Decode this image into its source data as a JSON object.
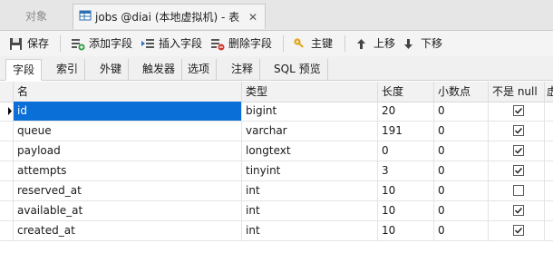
{
  "window_tabs": [
    {
      "label": "对象"
    },
    {
      "label": "jobs @diai (本地虚拟机) - 表",
      "close": "✕"
    }
  ],
  "toolbar": {
    "save": "保存",
    "add_field": "添加字段",
    "insert_field": "插入字段",
    "delete_field": "删除字段",
    "primary_key": "主键",
    "move_up": "上移",
    "move_down": "下移"
  },
  "subtabs": [
    "字段",
    "索引",
    "外键",
    "触发器",
    "选项",
    "注释",
    "SQL 预览"
  ],
  "columns": [
    "名",
    "类型",
    "长度",
    "小数点",
    "不是 null",
    "虚"
  ],
  "rows": [
    {
      "name": "id",
      "type": "bigint",
      "length": "20",
      "decimals": "0",
      "not_null": true
    },
    {
      "name": "queue",
      "type": "varchar",
      "length": "191",
      "decimals": "0",
      "not_null": true
    },
    {
      "name": "payload",
      "type": "longtext",
      "length": "0",
      "decimals": "0",
      "not_null": true
    },
    {
      "name": "attempts",
      "type": "tinyint",
      "length": "3",
      "decimals": "0",
      "not_null": true
    },
    {
      "name": "reserved_at",
      "type": "int",
      "length": "10",
      "decimals": "0",
      "not_null": false
    },
    {
      "name": "available_at",
      "type": "int",
      "length": "10",
      "decimals": "0",
      "not_null": true
    },
    {
      "name": "created_at",
      "type": "int",
      "length": "10",
      "decimals": "0",
      "not_null": true
    }
  ],
  "selected_row": 0,
  "colors": {
    "selection": "#0a6fd6",
    "tab_bg": "#e6e6e6",
    "toolbar_bg": "#f4f4f4"
  },
  "icons": [
    "table-icon",
    "save-icon",
    "add-field-icon",
    "insert-field-icon",
    "delete-field-icon",
    "key-icon",
    "arrow-up-icon",
    "arrow-down-icon",
    "row-pointer-icon",
    "checkmark-icon"
  ]
}
